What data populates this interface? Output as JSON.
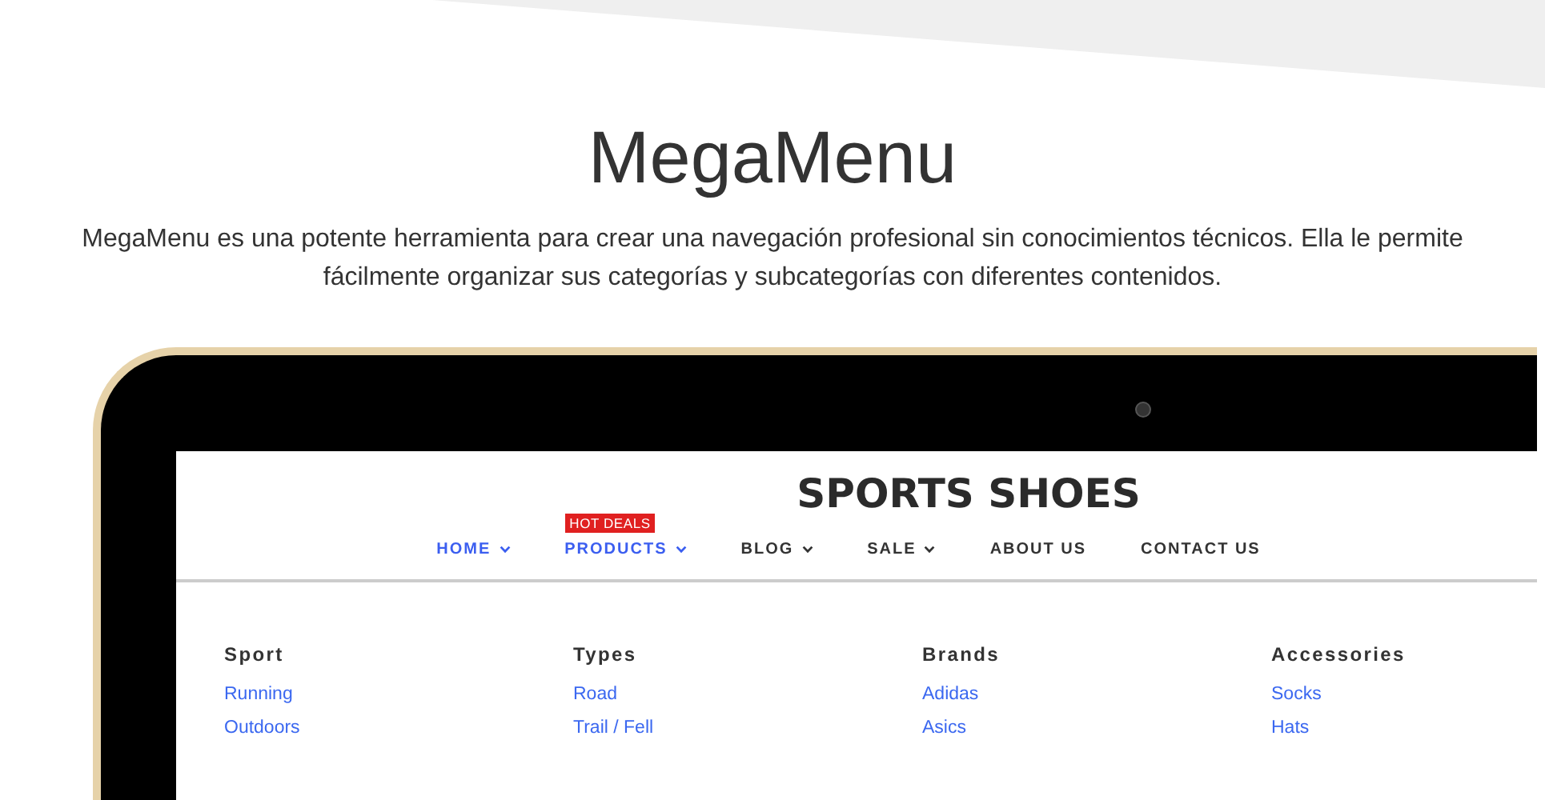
{
  "title": "MegaMenu",
  "description": "MegaMenu es una potente herramienta para crear una navegación profesional sin conocimientos técnicos. Ella le permite fácilmente organizar sus categorías y subcategorías con diferentes contenidos.",
  "store": {
    "name": "SPORTS SHOES",
    "nav": [
      {
        "label": "HOME",
        "selected": true,
        "dropdown": true
      },
      {
        "label": "PRODUCTS",
        "selected": true,
        "dropdown": true,
        "badge": "HOT DEALS"
      },
      {
        "label": "BLOG",
        "selected": false,
        "dropdown": true
      },
      {
        "label": "SALE",
        "selected": false,
        "dropdown": true
      },
      {
        "label": "ABOUT US",
        "selected": false,
        "dropdown": false
      },
      {
        "label": "CONTACT US",
        "selected": false,
        "dropdown": false
      }
    ],
    "menu_columns": [
      {
        "heading": "Sport",
        "links": [
          "Running",
          "Outdoors"
        ]
      },
      {
        "heading": "Types",
        "links": [
          "Road",
          "Trail / Fell"
        ]
      },
      {
        "heading": "Brands",
        "links": [
          "Adidas",
          "Asics"
        ]
      },
      {
        "heading": "Accessories",
        "links": [
          "Socks",
          "Hats"
        ]
      }
    ]
  }
}
